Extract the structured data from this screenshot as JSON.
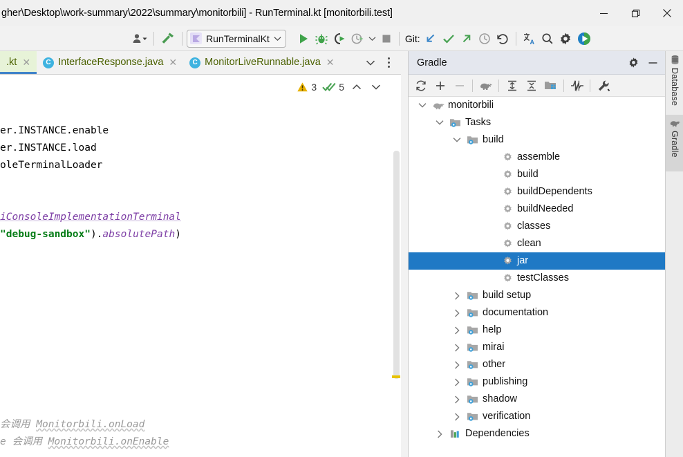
{
  "window": {
    "title": "gher\\Desktop\\work-summary\\2022\\summary\\monitorbili] - RunTerminal.kt [monitorbili.test]",
    "minimize_label": "–",
    "maximize_label": "❐",
    "close_label": "✕"
  },
  "toolbar": {
    "avatar_name": "user-avatar-icon",
    "build_name": "build-hammer-icon",
    "run_config": {
      "label": "RunTerminalKt",
      "icon": "kotlin-file-icon",
      "chevron": "∨"
    },
    "run_label": "run-button",
    "debug_label": "debug-button",
    "run_coverage_label": "run-with-coverage-button",
    "profile_label": "profiler-button",
    "stop_label": "stop-button",
    "git_label": "Git:",
    "git_update_label": "update-project-button",
    "git_commit_label": "commit-button",
    "git_push_label": "push-button",
    "git_history_label": "history-button",
    "git_rollback_label": "rollback-button",
    "translate_label": "translate-button",
    "search_label": "search-everywhere-button",
    "settings_label": "settings-button",
    "extra_run_label": "run-anything-button"
  },
  "tabs": {
    "items": [
      {
        "label": ".kt",
        "icon": "kotlin-file-icon",
        "active": true,
        "closable": true
      },
      {
        "label": "InterfaceResponse.java",
        "icon": "java-class-icon",
        "active": false,
        "closable": true
      },
      {
        "label": "MonitorLiveRunnable.java",
        "icon": "java-class-icon",
        "active": false,
        "closable": true
      }
    ],
    "dropdown_label": "∨",
    "options_label": "⋮"
  },
  "inspections": {
    "warning_count": "3",
    "check_count": "5",
    "prev_label": "∧",
    "next_label": "∨"
  },
  "editor": {
    "lines": [
      {
        "segments": []
      },
      {
        "segments": [
          {
            "text": "er.INSTANCE.enable",
            "style": "plain"
          }
        ]
      },
      {
        "segments": [
          {
            "text": "er.INSTANCE.load",
            "style": "plain"
          }
        ]
      },
      {
        "segments": [
          {
            "text": "oleTerminalLoader",
            "style": "plain"
          }
        ]
      },
      {
        "segments": []
      },
      {
        "segments": []
      },
      {
        "segments": [
          {
            "text": "iConsoleImplementationTerminal",
            "style": "ident-it"
          }
        ]
      },
      {
        "segments": [
          {
            "text": "\"debug-sandbox\"",
            "style": "str"
          },
          {
            "text": ").",
            "style": "plain"
          },
          {
            "text": "absolutePath",
            "style": "prop-it"
          },
          {
            "text": ")",
            "style": "plain"
          }
        ]
      },
      {
        "segments": []
      },
      {
        "segments": []
      },
      {
        "segments": []
      },
      {
        "segments": []
      },
      {
        "segments": []
      },
      {
        "segments": []
      },
      {
        "segments": []
      },
      {
        "segments": []
      },
      {
        "segments": []
      },
      {
        "segments": []
      },
      {
        "segments": [
          {
            "text": "会调用 ",
            "style": "comment"
          },
          {
            "text": "Monitorbili.onLoad",
            "style": "comment-u"
          }
        ]
      },
      {
        "segments": [
          {
            "text": "e 会调用 ",
            "style": "comment"
          },
          {
            "text": "Monitorbili.onEnable",
            "style": "comment-u"
          }
        ]
      }
    ]
  },
  "gradle": {
    "title": "Gradle",
    "header_settings_label": "gradle-settings-button",
    "header_hide_label": "hide-tool-window-button",
    "toolbar": [
      {
        "name": "refresh-all-gradle-projects-button",
        "icon": "refresh-icon",
        "disabled": false
      },
      {
        "name": "link-gradle-project-button",
        "icon": "plus-icon",
        "disabled": false
      },
      {
        "name": "detach-external-project-button",
        "icon": "minus-icon",
        "disabled": true
      },
      {
        "name": "execute-gradle-task-button",
        "icon": "gradle-elephant-icon",
        "disabled": false
      },
      {
        "name": "expand-all-button",
        "icon": "expand-all-icon",
        "disabled": false
      },
      {
        "name": "collapse-all-button",
        "icon": "collapse-all-icon",
        "disabled": false
      },
      {
        "name": "group-modules-button",
        "icon": "module-group-icon",
        "disabled": false
      },
      {
        "name": "toggle-offline-mode-button",
        "icon": "offline-mode-icon",
        "disabled": false
      },
      {
        "name": "gradle-build-tool-settings-button",
        "icon": "wrench-icon",
        "disabled": false
      }
    ],
    "tree": [
      {
        "label": "monitorbili",
        "depth": 0,
        "icon": "gradle-elephant-icon",
        "twisty": "expanded",
        "selected": false
      },
      {
        "label": "Tasks",
        "depth": 1,
        "icon": "task-folder-icon",
        "twisty": "expanded",
        "selected": false
      },
      {
        "label": "build",
        "depth": 2,
        "icon": "task-folder-icon",
        "twisty": "expanded",
        "selected": false
      },
      {
        "label": "assemble",
        "depth": 4,
        "icon": "gear-task-icon",
        "twisty": "none",
        "selected": false
      },
      {
        "label": "build",
        "depth": 4,
        "icon": "gear-task-icon",
        "twisty": "none",
        "selected": false
      },
      {
        "label": "buildDependents",
        "depth": 4,
        "icon": "gear-task-icon",
        "twisty": "none",
        "selected": false
      },
      {
        "label": "buildNeeded",
        "depth": 4,
        "icon": "gear-task-icon",
        "twisty": "none",
        "selected": false
      },
      {
        "label": "classes",
        "depth": 4,
        "icon": "gear-task-icon",
        "twisty": "none",
        "selected": false
      },
      {
        "label": "clean",
        "depth": 4,
        "icon": "gear-task-icon",
        "twisty": "none",
        "selected": false
      },
      {
        "label": "jar",
        "depth": 4,
        "icon": "gear-task-icon",
        "twisty": "none",
        "selected": true
      },
      {
        "label": "testClasses",
        "depth": 4,
        "icon": "gear-task-icon",
        "twisty": "none",
        "selected": false
      },
      {
        "label": "build setup",
        "depth": 2,
        "icon": "task-folder-icon",
        "twisty": "collapsed",
        "selected": false
      },
      {
        "label": "documentation",
        "depth": 2,
        "icon": "task-folder-icon",
        "twisty": "collapsed",
        "selected": false
      },
      {
        "label": "help",
        "depth": 2,
        "icon": "task-folder-icon",
        "twisty": "collapsed",
        "selected": false
      },
      {
        "label": "mirai",
        "depth": 2,
        "icon": "task-folder-icon",
        "twisty": "collapsed",
        "selected": false
      },
      {
        "label": "other",
        "depth": 2,
        "icon": "task-folder-icon",
        "twisty": "collapsed",
        "selected": false
      },
      {
        "label": "publishing",
        "depth": 2,
        "icon": "task-folder-icon",
        "twisty": "collapsed",
        "selected": false
      },
      {
        "label": "shadow",
        "depth": 2,
        "icon": "task-folder-icon",
        "twisty": "collapsed",
        "selected": false
      },
      {
        "label": "verification",
        "depth": 2,
        "icon": "task-folder-icon",
        "twisty": "collapsed",
        "selected": false
      },
      {
        "label": "Dependencies",
        "depth": 1,
        "icon": "dependencies-icon",
        "twisty": "collapsed",
        "selected": false
      }
    ]
  },
  "stripe": {
    "items": [
      {
        "label": "Database",
        "icon": "database-icon",
        "active": false
      },
      {
        "label": "Gradle",
        "icon": "gradle-elephant-icon",
        "active": true
      }
    ]
  },
  "colors": {
    "selection_blue": "#1f79c5",
    "tab_text_olive": "#4b6100",
    "active_tab_bg": "#e7f3d8",
    "tab_underline": "#4083c9",
    "string_green": "#067d17",
    "identifier_purple": "#7d3ea5",
    "comment_gray": "#9a9a9a",
    "warning_yellow": "#e8c300",
    "gradle_header_bg": "#e4e7ee"
  }
}
